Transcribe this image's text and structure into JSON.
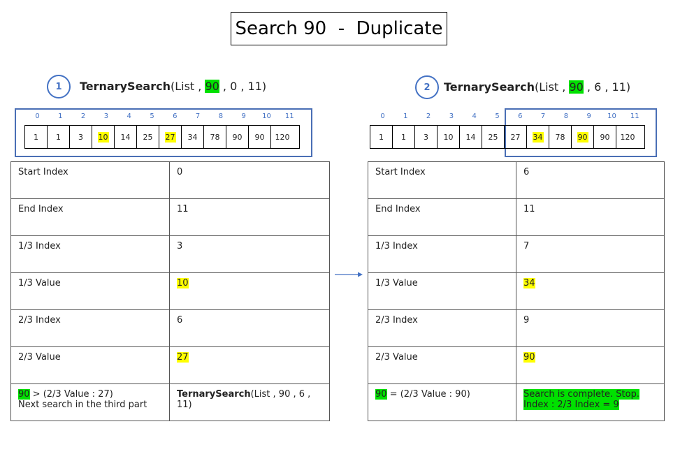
{
  "title": "Search 90  -  Duplicate",
  "indices": [
    "0",
    "1",
    "2",
    "3",
    "4",
    "5",
    "6",
    "7",
    "8",
    "9",
    "10",
    "11"
  ],
  "array": [
    "1",
    "1",
    "3",
    "10",
    "14",
    "25",
    "27",
    "34",
    "78",
    "90",
    "90",
    "120"
  ],
  "left": {
    "number": "1",
    "call": {
      "func": "TernarySearch",
      "open": "(List , ",
      "target": "90",
      "rest": " , 0 , 11)"
    },
    "highlight_cells": [
      3,
      6
    ],
    "rows": [
      {
        "label": "Start Index",
        "value": "0"
      },
      {
        "label": "End Index",
        "value": "11"
      },
      {
        "label": "1/3 Index",
        "value": "3"
      },
      {
        "label": "1/3 Value",
        "value": "10"
      },
      {
        "label": "2/3 Index",
        "value": "6"
      },
      {
        "label": "2/3 Value",
        "value": "27"
      }
    ],
    "footer": {
      "cond_target": "90",
      "cond_rest": " > (2/3 Value : 27)",
      "cond_line2": "Next search in the third part",
      "result_func": "TernarySearch",
      "result_rest": "(List , 90 , 6 , 11)"
    }
  },
  "right": {
    "number": "2",
    "call": {
      "func": "TernarySearch",
      "open": "(List , ",
      "target": "90",
      "rest": " , 6 , 11)"
    },
    "highlight_cells": [
      7,
      9
    ],
    "rows": [
      {
        "label": "Start Index",
        "value": "6"
      },
      {
        "label": "End Index",
        "value": "11"
      },
      {
        "label": "1/3 Index",
        "value": "7"
      },
      {
        "label": "1/3 Value",
        "value": "34"
      },
      {
        "label": "2/3 Index",
        "value": "9"
      },
      {
        "label": "2/3 Value",
        "value": "90"
      }
    ],
    "footer": {
      "cond_target": "90",
      "cond_rest": " = (2/3 Value : 90)",
      "result_line1": "Search is complete. Stop.",
      "result_line2": "Index : 2/3 Index = 9"
    }
  },
  "colors": {
    "accent_blue": "#4472c4",
    "highlight_green": "#00e000",
    "highlight_yellow": "#ffff00"
  }
}
